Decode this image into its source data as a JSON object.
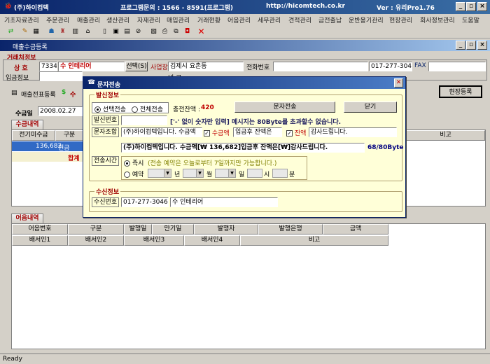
{
  "window": {
    "title": "(주)하이컴텍",
    "support": "프로그램문의 : 1566 - 8591(프로그램)",
    "site": "http://hicomtech.co.kr",
    "version": "Ver : 유리Pro1.76"
  },
  "menu": [
    "기초자료관리",
    "주문관리",
    "매출관리",
    "생산관리",
    "자재관리",
    "매입관리",
    "거래현황",
    "어음관리",
    "세무관리",
    "견적관리",
    "금전출납",
    "운반용기관리",
    "현장관리",
    "회사정보관리",
    "도움말"
  ],
  "subwindow": {
    "title": "매출수금등록"
  },
  "client": {
    "section": "거래처정보",
    "label_code": "상  호",
    "code": "7334",
    "name": "수 인테리어",
    "select_btn": "선택(S)",
    "label_bizno": "사업장",
    "address": "김제시 요촌동",
    "label_phone": "전화번호",
    "mobile": "017-277-3046",
    "fax_label": "FAX",
    "label_deposit": "입금정보",
    "label_bigo": "비 고"
  },
  "toolbar2": {
    "print_label": "매출전표등록",
    "receipt_label": "수",
    "site_btn": "현장등록"
  },
  "collect": {
    "label_date": "수금일",
    "date": "2008.02.27",
    "tab": "수금내역",
    "headers": [
      "전기미수금",
      "구분"
    ],
    "row_amount": "136,682",
    "row_type": "현금",
    "total_label": "합계",
    "right_header": "비고"
  },
  "bill": {
    "tab": "어음내역",
    "headers1": [
      "어음번호",
      "구분",
      "발행일",
      "만기일",
      "발행자",
      "발행은행",
      "금액"
    ],
    "headers2": [
      "배서인1",
      "배서인2",
      "배서인3",
      "배서인4",
      "비고"
    ]
  },
  "status": "Ready",
  "dialog": {
    "title": "문자전송",
    "send_section": "발신정보",
    "radio_selected": "선택전송",
    "radio_all": "전체전송",
    "balance_label": "충전잔액 :",
    "balance": "420",
    "send_btn": "문자전송",
    "close_btn": "닫기",
    "sender_label": "발신번호",
    "sender_hint": "['-' 없이 숫자만 입력]  메시지는 80Byte를 초과할수 없습니다.",
    "combo_label": "문자조합",
    "combo_part1": "(주)하이컴텍입니다. 수금액",
    "combo_chk1": "수금액",
    "combo_part2": "입금후 잔액은",
    "combo_chk2": "잔액",
    "combo_part3": "감사드립니다.",
    "message": "(주)하이컴텍입니다. 수금액[₩ 136,682]입금후 잔액은[₩]감사드립니다.",
    "byte_count": "68/80Byte",
    "time_label": "전송시간",
    "immediate": "즉시",
    "immediate_note": "(전송 예약은 오늘로부터 7일까지만 가능합니다.)",
    "reserve": "예약",
    "year": "년",
    "month": "월",
    "day": "일",
    "hour": "시",
    "minute": "분",
    "recv_section": "수신정보",
    "recv_label": "수신번호",
    "recv_number": "017-277-3046",
    "recv_name": "수 인테리어"
  },
  "colors": {
    "title_dark": "#0a246a",
    "title_light": "#3a6ea5",
    "accent_red": "#a00000",
    "dialog_bg": "#ffffd8",
    "highlight_blue": "#316ac5",
    "byte_count_blue": "#000080"
  }
}
